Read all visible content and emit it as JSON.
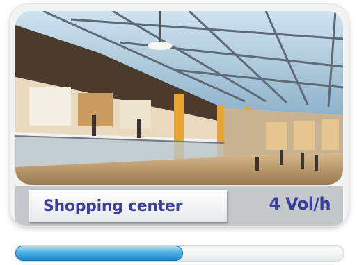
{
  "location_card": {
    "image_name": "mall-interior-photo",
    "label": "Shopping center",
    "rate": "4 Vol/h"
  },
  "progress": {
    "fraction": 0.51,
    "color": "#2a93d6"
  },
  "colors": {
    "label_text": "#3a3f9e",
    "label_bar": "#c4c8ca"
  }
}
